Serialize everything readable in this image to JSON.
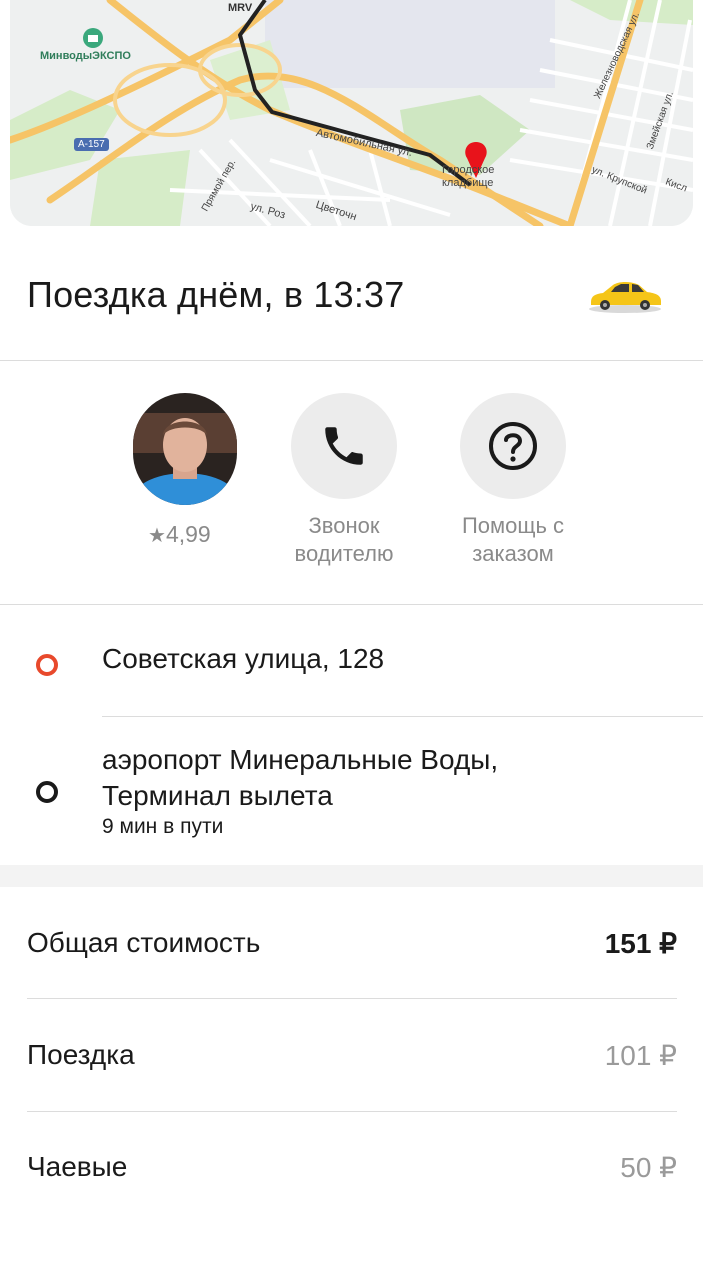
{
  "map": {
    "labels": {
      "expo": "МинводыЭКСПО",
      "mrv": "MRV",
      "road": "А-157",
      "avto": "Автомобильная ул.",
      "pryamoy": "Прямой пер.",
      "roz": "ул. Роз",
      "tsvet": "Цветочн",
      "cemetery": "Городское кладбище",
      "zhelezno": "Железноводская ул.",
      "zmeyskaya": "Змейская ул.",
      "krupskoy": "ул. Крупской",
      "kisl": "Кисл"
    }
  },
  "trip": {
    "title": "Поездка днём, в 13:37"
  },
  "driver": {
    "rating": "4,99",
    "call_label": "Звонок водителю",
    "help_label": "Помощь с заказом"
  },
  "route": {
    "from": "Советская улица, 128",
    "to_line1": "аэропорт Минеральные Воды,",
    "to_line2": "Терминал вылета",
    "duration": "9 мин в пути"
  },
  "cost": {
    "total_label": "Общая стоимость",
    "total_value": "151 ₽",
    "ride_label": "Поездка",
    "ride_value": "101 ₽",
    "tips_label": "Чаевые",
    "tips_value": "50 ₽"
  }
}
